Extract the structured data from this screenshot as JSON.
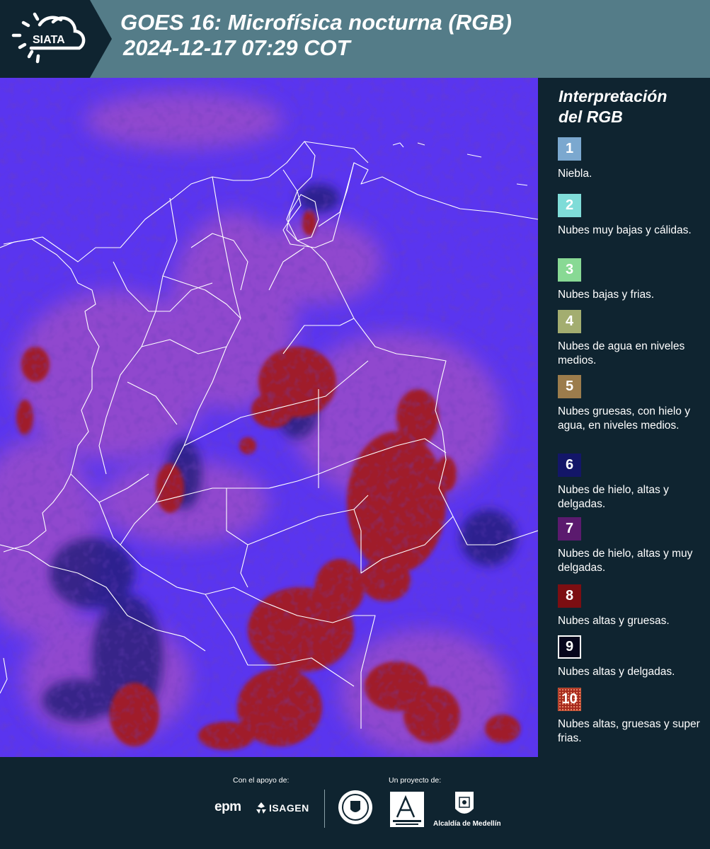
{
  "header": {
    "logo_text": "SIATA",
    "title_line1": "GOES 16: Microfísica nocturna (RGB)",
    "title_line2": "2024-12-17 07:29 COT"
  },
  "map": {
    "background_color": "#5a35ef",
    "cloud_colors": {
      "thick_high": "#a01a2a",
      "thin_high": "#201c78",
      "mid_pink": "#a24fc4"
    },
    "border_color": "#ffffff"
  },
  "legend": {
    "title_line1": "Interpretación",
    "title_line2": "del RGB",
    "items": [
      {
        "number": "1",
        "color": "#7ba8cf",
        "label": "Niebla."
      },
      {
        "number": "2",
        "color": "#7fdcd8",
        "label": "Nubes muy bajas y cálidas."
      },
      {
        "number": "3",
        "color": "#88d994",
        "label": "Nubes bajas y frias."
      },
      {
        "number": "4",
        "color": "#a3ad70",
        "label": "Nubes de agua en niveles medios."
      },
      {
        "number": "5",
        "color": "#9c7c4c",
        "label": "Nubes gruesas, con hielo y agua, en niveles medios."
      },
      {
        "number": "6",
        "color": "#131668",
        "label": "Nubes de hielo, altas y delgadas."
      },
      {
        "number": "7",
        "color": "#5b1a6e",
        "label": "Nubes de hielo, altas y muy delgadas."
      },
      {
        "number": "8",
        "color": "#7c0e12",
        "label": "Nubes altas y gruesas."
      },
      {
        "number": "9",
        "color": "#06061c",
        "label": "Nubes altas y delgadas."
      },
      {
        "number": "10",
        "color": "#a52a1e",
        "label": "Nubes altas, gruesas y super frias."
      }
    ]
  },
  "footer": {
    "support_label": "Con el apoyo de:",
    "project_label": "Un proyecto de:",
    "sponsors": [
      "epm",
      "ISAGEN"
    ],
    "partners": [
      "Área Metropolitana Valle de Aburrá",
      "Alcaldía de Medellín"
    ],
    "alcaldia_label": "Alcaldía de Medellín"
  }
}
